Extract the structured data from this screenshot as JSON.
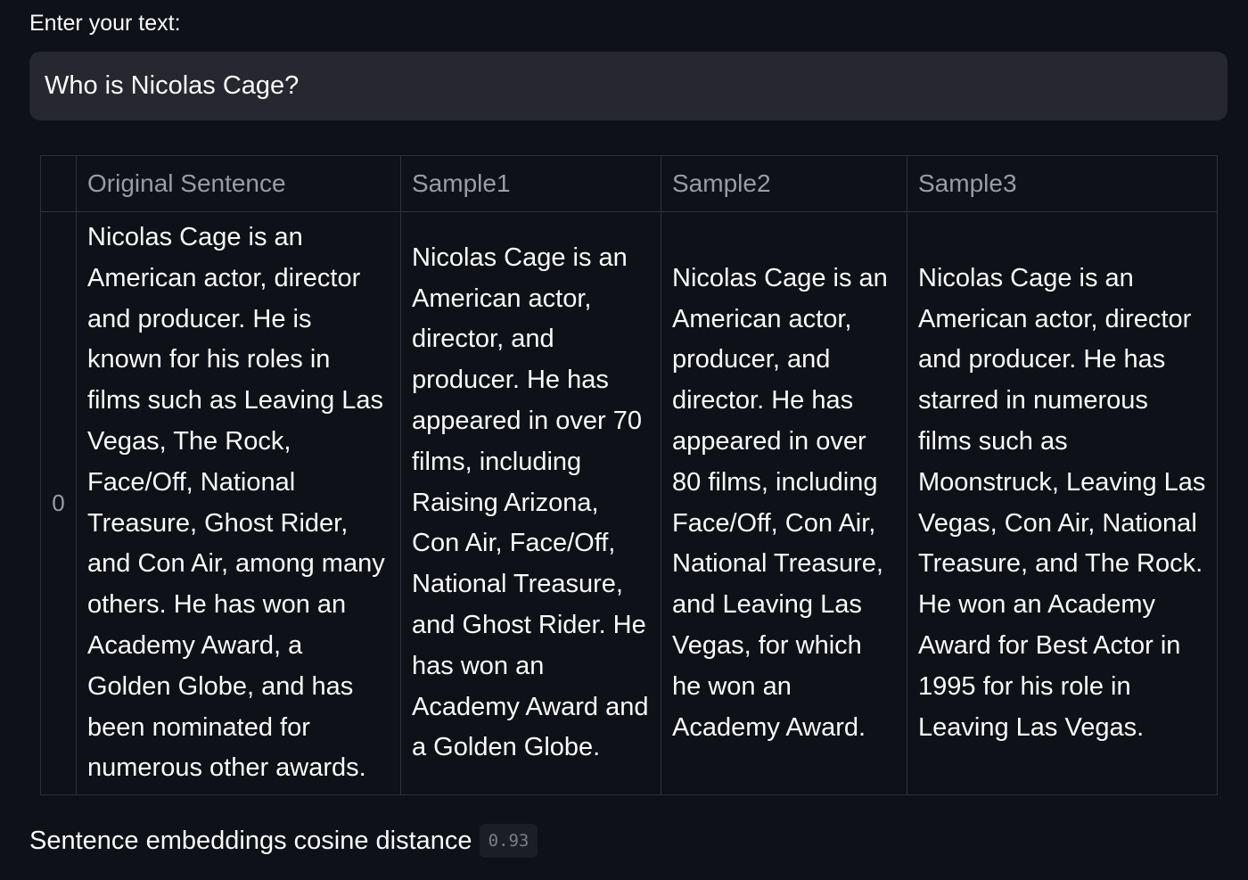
{
  "input": {
    "label": "Enter your text:",
    "value": "Who is Nicolas Cage?"
  },
  "table": {
    "headers": [
      "",
      "Original Sentence",
      "Sample1",
      "Sample2",
      "Sample3"
    ],
    "rows": [
      {
        "index": "0",
        "original": "Nicolas Cage is an American actor, director and producer. He is known for his roles in films such as Leaving Las Vegas, The Rock, Face/Off, National Treasure, Ghost Rider, and Con Air, among many others. He has won an Academy Award, a Golden Globe, and has been nominated for numerous other awards.",
        "sample1": "Nicolas Cage is an American actor, director, and producer. He has appeared in over 70 films, including Raising Arizona, Con Air, Face/Off, National Treasure, and Ghost Rider. He has won an Academy Award and a Golden Globe.",
        "sample2": "Nicolas Cage is an American actor, producer, and director. He has appeared in over 80 films, including Face/Off, Con Air, National Treasure, and Leaving Las Vegas, for which he won an Academy Award.",
        "sample3": "Nicolas Cage is an American actor, director and producer. He has starred in numerous films such as Moonstruck, Leaving Las Vegas, Con Air, National Treasure, and The Rock. He won an Academy Award for Best Actor in 1995 for his role in Leaving Las Vegas."
      }
    ]
  },
  "result": {
    "label": "Sentence embeddings cosine distance",
    "value": "0.93"
  }
}
